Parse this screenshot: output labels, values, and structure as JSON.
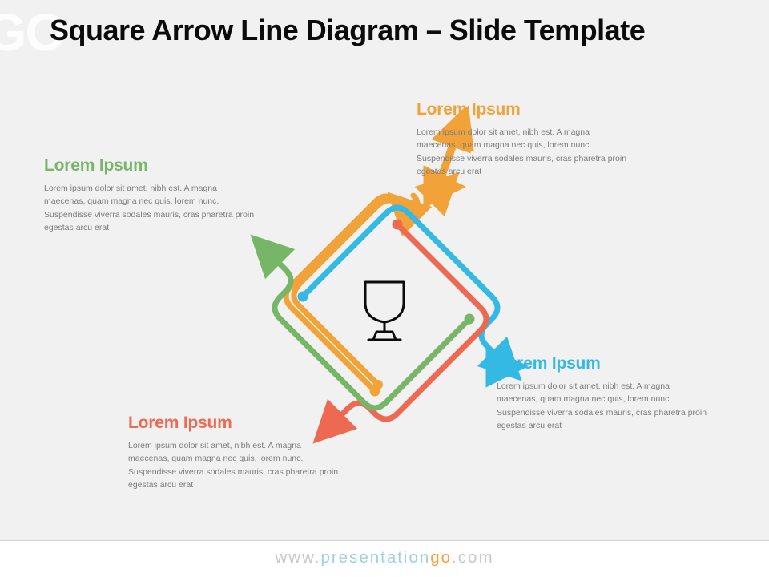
{
  "title": "Square Arrow Line Diagram – Slide Template",
  "center_icon": "trophy-icon",
  "callouts": {
    "green": {
      "heading": "Lorem Ipsum",
      "body": "Lorem ipsum dolor sit amet, nibh est. A magna maecenas, quam magna nec quis, lorem nunc. Suspendisse viverra sodales mauris, cras pharetra proin egestas arcu erat",
      "color": "#77b567"
    },
    "orange": {
      "heading": "Lorem Ipsum",
      "body": "Lorem ipsum dolor sit amet, nibh est. A magna maecenas, quam magna nec quis, lorem nunc. Suspendisse viverra sodales mauris, cras pharetra proin egestas arcu erat",
      "color": "#f1a33a"
    },
    "blue": {
      "heading": "Lorem Ipsum",
      "body": "Lorem ipsum dolor sit amet, nibh est. A magna maecenas, quam magna nec quis, lorem nunc. Suspendisse viverra sodales mauris, cras pharetra proin egestas arcu erat",
      "color": "#33b9e3"
    },
    "red": {
      "heading": "Lorem Ipsum",
      "body": "Lorem ipsum dolor sit amet, nibh est. A magna maecenas, quam magna nec quis, lorem nunc. Suspendisse viverra sodales mauris, cras pharetra proin egestas arcu erat",
      "color": "#ee6951"
    }
  },
  "footer": {
    "prefix": "www.",
    "brand_a": "presentation",
    "brand_b": "go",
    "suffix": ".com"
  },
  "watermark": "GO"
}
